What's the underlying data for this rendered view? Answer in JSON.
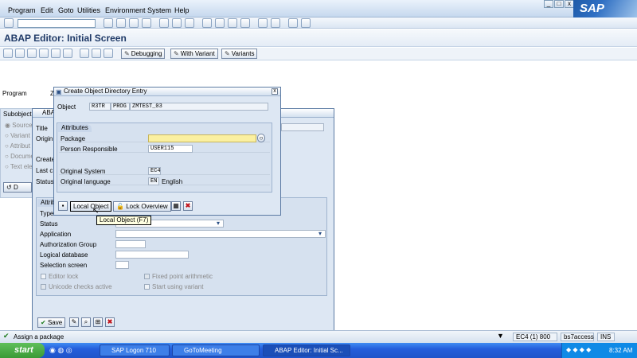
{
  "menu": [
    "Program",
    "Edit",
    "Goto",
    "Utilities",
    "Environment",
    "System",
    "Help"
  ],
  "brand": "SAP",
  "window_buttons": [
    "_",
    "□",
    "x"
  ],
  "title": "ABAP Editor: Initial Screen",
  "toolbar": {
    "debugging": "Debugging",
    "with_variant": "With Variant",
    "variants": "Variants"
  },
  "main": {
    "program_label": "Program",
    "subobjects_label": "Subobject",
    "subobject_options": [
      "Source",
      "Variant",
      "Attribut",
      "Docume",
      "Text ele"
    ],
    "display_btn": "D"
  },
  "attributes_dialog": {
    "title": "ABA",
    "left_labels": [
      "Title",
      "Origin",
      "Create",
      "Last c",
      "Status"
    ],
    "section_title": "Attrib",
    "rows": [
      "Type",
      "Status",
      "Application",
      "Authorization Group",
      "Logical database",
      "Selection screen"
    ],
    "checkboxes": {
      "editor_lock": "Editor lock",
      "fixed_point": "Fixed point arithmetic",
      "unicode": "Unicode checks active",
      "start_variant": "Start using variant"
    },
    "save_label": "Save"
  },
  "create_dialog": {
    "title": "Create Object Directory Entry",
    "object_label": "Object",
    "object_values": [
      "R3TR",
      "PROG",
      "ZMTEST_03"
    ],
    "attributes_title": "Attributes",
    "package_label": "Package",
    "package_value": "",
    "person_label": "Person Responsible",
    "person_value": "USER115",
    "orig_system_label": "Original System",
    "orig_system_value": "EC4",
    "orig_lang_label": "Original language",
    "orig_lang_code": "EN",
    "orig_lang_name": "English",
    "local_object_label": "Local Object",
    "lock_overview_label": "Lock Overview"
  },
  "tooltip": "Local Object   (F7)",
  "status": {
    "message": "Assign a package",
    "system": "EC4 (1) 800",
    "server": "bs7access",
    "mode": "INS"
  },
  "taskbar": {
    "start": "start",
    "tasks": [
      "SAP Logon 710",
      "GoToMeeting",
      "ABAP Editor: Initial Sc..."
    ],
    "clock": "8:32 AM"
  },
  "colors": {
    "sap_blue": "#1e5aa8",
    "dialog_bg": "#dde7f3",
    "required_field": "#fbf0a0",
    "taskbar": "#245edb"
  }
}
